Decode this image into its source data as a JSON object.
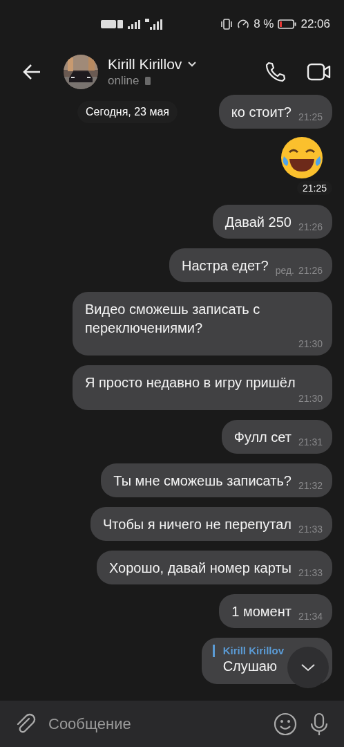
{
  "status_bar": {
    "battery": "8 %",
    "time": "22:06"
  },
  "header": {
    "name": "Kirill Kirillov",
    "status": "online"
  },
  "date_pill": "Сегодня, 23 мая",
  "messages": [
    {
      "kind": "text",
      "text": "ко стоит?",
      "time": "21:25"
    },
    {
      "kind": "emoji",
      "time": "21:25"
    },
    {
      "kind": "text",
      "text": "Давай 250",
      "time": "21:26"
    },
    {
      "kind": "text",
      "text": "Настра едет?",
      "edited_mark": "ред.",
      "time": "21:26"
    },
    {
      "kind": "text",
      "text": "Видео сможешь записать с переключениями?",
      "time": "21:30"
    },
    {
      "kind": "text",
      "text": "Я просто недавно в игру пришёл",
      "time": "21:30"
    },
    {
      "kind": "text",
      "text": "Фулл сет",
      "time": "21:31"
    },
    {
      "kind": "text",
      "text": "Ты мне сможешь записать?",
      "time": "21:32"
    },
    {
      "kind": "text",
      "text": "Чтобы я ничего не перепутал",
      "time": "21:33"
    },
    {
      "kind": "text",
      "text": "Хорошо, давай номер карты",
      "time": "21:33"
    },
    {
      "kind": "text",
      "text": "1 момент",
      "time": "21:34"
    },
    {
      "kind": "reply",
      "reply_author": "Kirill Kirillov",
      "text": "Слушаю"
    }
  ],
  "input": {
    "placeholder": "Сообщение"
  }
}
